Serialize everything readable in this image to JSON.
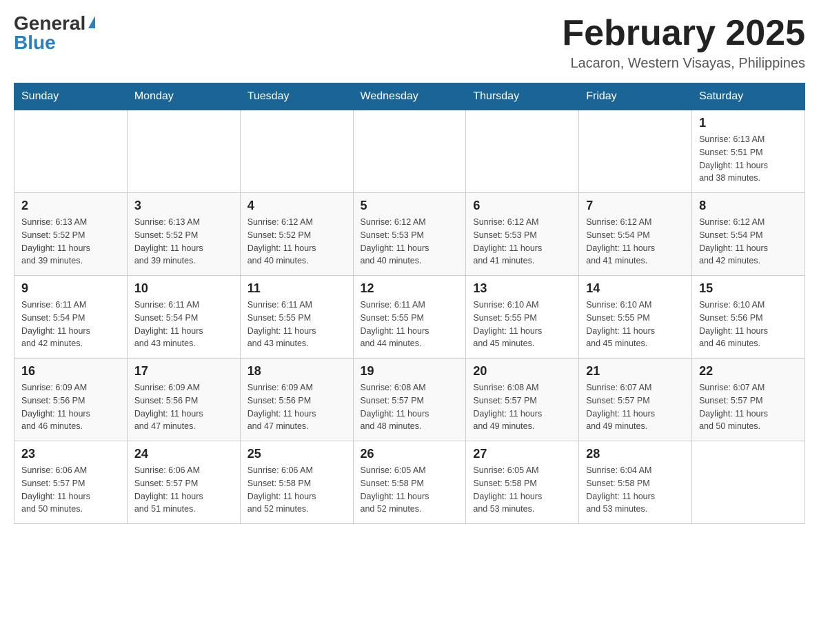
{
  "header": {
    "logo_general": "General",
    "logo_blue": "Blue",
    "month_title": "February 2025",
    "location": "Lacaron, Western Visayas, Philippines"
  },
  "days_of_week": [
    "Sunday",
    "Monday",
    "Tuesday",
    "Wednesday",
    "Thursday",
    "Friday",
    "Saturday"
  ],
  "weeks": [
    {
      "days": [
        {
          "date": "",
          "info": ""
        },
        {
          "date": "",
          "info": ""
        },
        {
          "date": "",
          "info": ""
        },
        {
          "date": "",
          "info": ""
        },
        {
          "date": "",
          "info": ""
        },
        {
          "date": "",
          "info": ""
        },
        {
          "date": "1",
          "info": "Sunrise: 6:13 AM\nSunset: 5:51 PM\nDaylight: 11 hours\nand 38 minutes."
        }
      ]
    },
    {
      "days": [
        {
          "date": "2",
          "info": "Sunrise: 6:13 AM\nSunset: 5:52 PM\nDaylight: 11 hours\nand 39 minutes."
        },
        {
          "date": "3",
          "info": "Sunrise: 6:13 AM\nSunset: 5:52 PM\nDaylight: 11 hours\nand 39 minutes."
        },
        {
          "date": "4",
          "info": "Sunrise: 6:12 AM\nSunset: 5:52 PM\nDaylight: 11 hours\nand 40 minutes."
        },
        {
          "date": "5",
          "info": "Sunrise: 6:12 AM\nSunset: 5:53 PM\nDaylight: 11 hours\nand 40 minutes."
        },
        {
          "date": "6",
          "info": "Sunrise: 6:12 AM\nSunset: 5:53 PM\nDaylight: 11 hours\nand 41 minutes."
        },
        {
          "date": "7",
          "info": "Sunrise: 6:12 AM\nSunset: 5:54 PM\nDaylight: 11 hours\nand 41 minutes."
        },
        {
          "date": "8",
          "info": "Sunrise: 6:12 AM\nSunset: 5:54 PM\nDaylight: 11 hours\nand 42 minutes."
        }
      ]
    },
    {
      "days": [
        {
          "date": "9",
          "info": "Sunrise: 6:11 AM\nSunset: 5:54 PM\nDaylight: 11 hours\nand 42 minutes."
        },
        {
          "date": "10",
          "info": "Sunrise: 6:11 AM\nSunset: 5:54 PM\nDaylight: 11 hours\nand 43 minutes."
        },
        {
          "date": "11",
          "info": "Sunrise: 6:11 AM\nSunset: 5:55 PM\nDaylight: 11 hours\nand 43 minutes."
        },
        {
          "date": "12",
          "info": "Sunrise: 6:11 AM\nSunset: 5:55 PM\nDaylight: 11 hours\nand 44 minutes."
        },
        {
          "date": "13",
          "info": "Sunrise: 6:10 AM\nSunset: 5:55 PM\nDaylight: 11 hours\nand 45 minutes."
        },
        {
          "date": "14",
          "info": "Sunrise: 6:10 AM\nSunset: 5:55 PM\nDaylight: 11 hours\nand 45 minutes."
        },
        {
          "date": "15",
          "info": "Sunrise: 6:10 AM\nSunset: 5:56 PM\nDaylight: 11 hours\nand 46 minutes."
        }
      ]
    },
    {
      "days": [
        {
          "date": "16",
          "info": "Sunrise: 6:09 AM\nSunset: 5:56 PM\nDaylight: 11 hours\nand 46 minutes."
        },
        {
          "date": "17",
          "info": "Sunrise: 6:09 AM\nSunset: 5:56 PM\nDaylight: 11 hours\nand 47 minutes."
        },
        {
          "date": "18",
          "info": "Sunrise: 6:09 AM\nSunset: 5:56 PM\nDaylight: 11 hours\nand 47 minutes."
        },
        {
          "date": "19",
          "info": "Sunrise: 6:08 AM\nSunset: 5:57 PM\nDaylight: 11 hours\nand 48 minutes."
        },
        {
          "date": "20",
          "info": "Sunrise: 6:08 AM\nSunset: 5:57 PM\nDaylight: 11 hours\nand 49 minutes."
        },
        {
          "date": "21",
          "info": "Sunrise: 6:07 AM\nSunset: 5:57 PM\nDaylight: 11 hours\nand 49 minutes."
        },
        {
          "date": "22",
          "info": "Sunrise: 6:07 AM\nSunset: 5:57 PM\nDaylight: 11 hours\nand 50 minutes."
        }
      ]
    },
    {
      "days": [
        {
          "date": "23",
          "info": "Sunrise: 6:06 AM\nSunset: 5:57 PM\nDaylight: 11 hours\nand 50 minutes."
        },
        {
          "date": "24",
          "info": "Sunrise: 6:06 AM\nSunset: 5:57 PM\nDaylight: 11 hours\nand 51 minutes."
        },
        {
          "date": "25",
          "info": "Sunrise: 6:06 AM\nSunset: 5:58 PM\nDaylight: 11 hours\nand 52 minutes."
        },
        {
          "date": "26",
          "info": "Sunrise: 6:05 AM\nSunset: 5:58 PM\nDaylight: 11 hours\nand 52 minutes."
        },
        {
          "date": "27",
          "info": "Sunrise: 6:05 AM\nSunset: 5:58 PM\nDaylight: 11 hours\nand 53 minutes."
        },
        {
          "date": "28",
          "info": "Sunrise: 6:04 AM\nSunset: 5:58 PM\nDaylight: 11 hours\nand 53 minutes."
        },
        {
          "date": "",
          "info": ""
        }
      ]
    }
  ]
}
